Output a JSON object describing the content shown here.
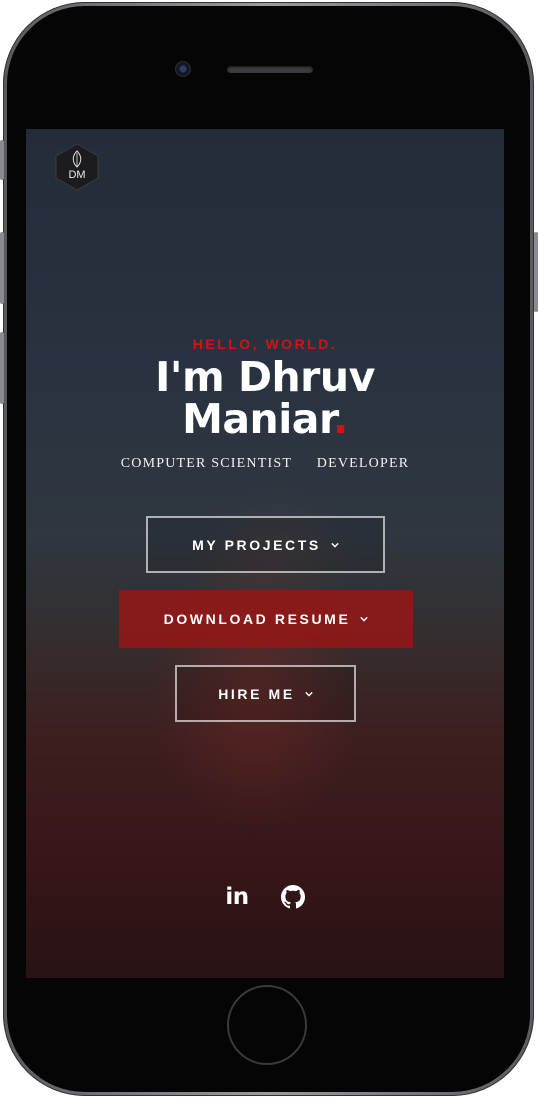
{
  "logo": {
    "monogram": "DM"
  },
  "hero": {
    "kicker": "HELLO, WORLD.",
    "name_line1": "I'm Dhruv",
    "name_line2": "Maniar",
    "name_dot": ".",
    "roles": [
      "COMPUTER SCIENTIST",
      "DEVELOPER"
    ]
  },
  "buttons": {
    "projects": "MY PROJECTS",
    "resume": "DOWNLOAD RESUME",
    "hire": "HIRE ME"
  },
  "social": {
    "linkedin_label": "in",
    "github_icon": "github-icon"
  },
  "colors": {
    "accent": "#d31313",
    "text": "#ffffff"
  }
}
